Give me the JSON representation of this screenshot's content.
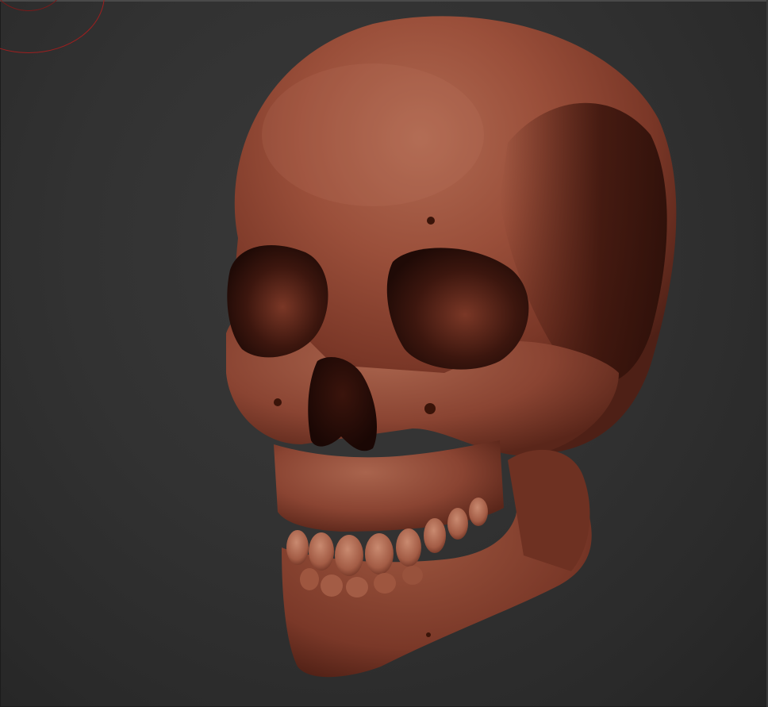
{
  "app": {
    "view": "3D viewport",
    "material_color": "#8a4332",
    "background_color": "#2f2f2f"
  },
  "viewport": {
    "brush_cursor_color": "#9e1f1f",
    "model_name": "skull-model-icon"
  }
}
